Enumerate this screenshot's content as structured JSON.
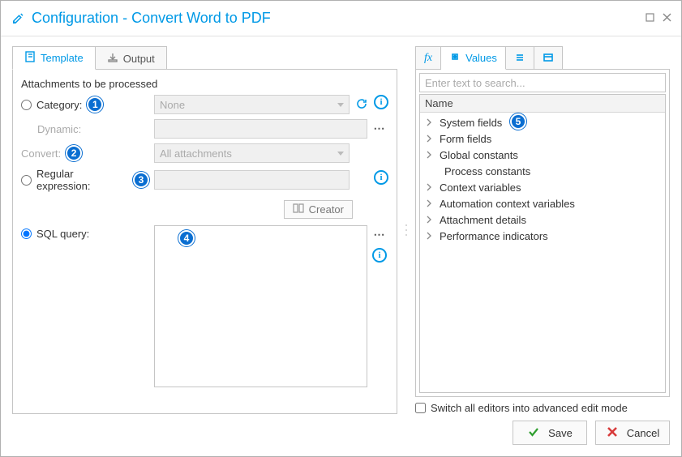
{
  "window": {
    "title": "Configuration - Convert Word to PDF"
  },
  "left": {
    "tabs": {
      "template": "Template",
      "output": "Output"
    },
    "section": "Attachments to be processed",
    "rows": {
      "category": {
        "label": "Category:",
        "value": "None"
      },
      "dynamic": {
        "label": "Dynamic:",
        "value": ""
      },
      "convert": {
        "label": "Convert:",
        "value": "All attachments"
      },
      "regex": {
        "label": "Regular expression:",
        "value": ""
      },
      "sql": {
        "label": "SQL query:",
        "value": ""
      }
    },
    "creator_label": "Creator"
  },
  "right": {
    "tabs": {
      "values": "Values"
    },
    "search_placeholder": "Enter text to search...",
    "grid_header": "Name",
    "items": [
      "System fields",
      "Form fields",
      "Global constants",
      "Process constants",
      "Context variables",
      "Automation context variables",
      "Attachment details",
      "Performance indicators"
    ],
    "advanced_label": "Switch all editors into advanced edit mode"
  },
  "footer": {
    "save": "Save",
    "cancel": "Cancel"
  },
  "badges": {
    "b1": "1",
    "b2": "2",
    "b3": "3",
    "b4": "4",
    "b5": "5"
  }
}
